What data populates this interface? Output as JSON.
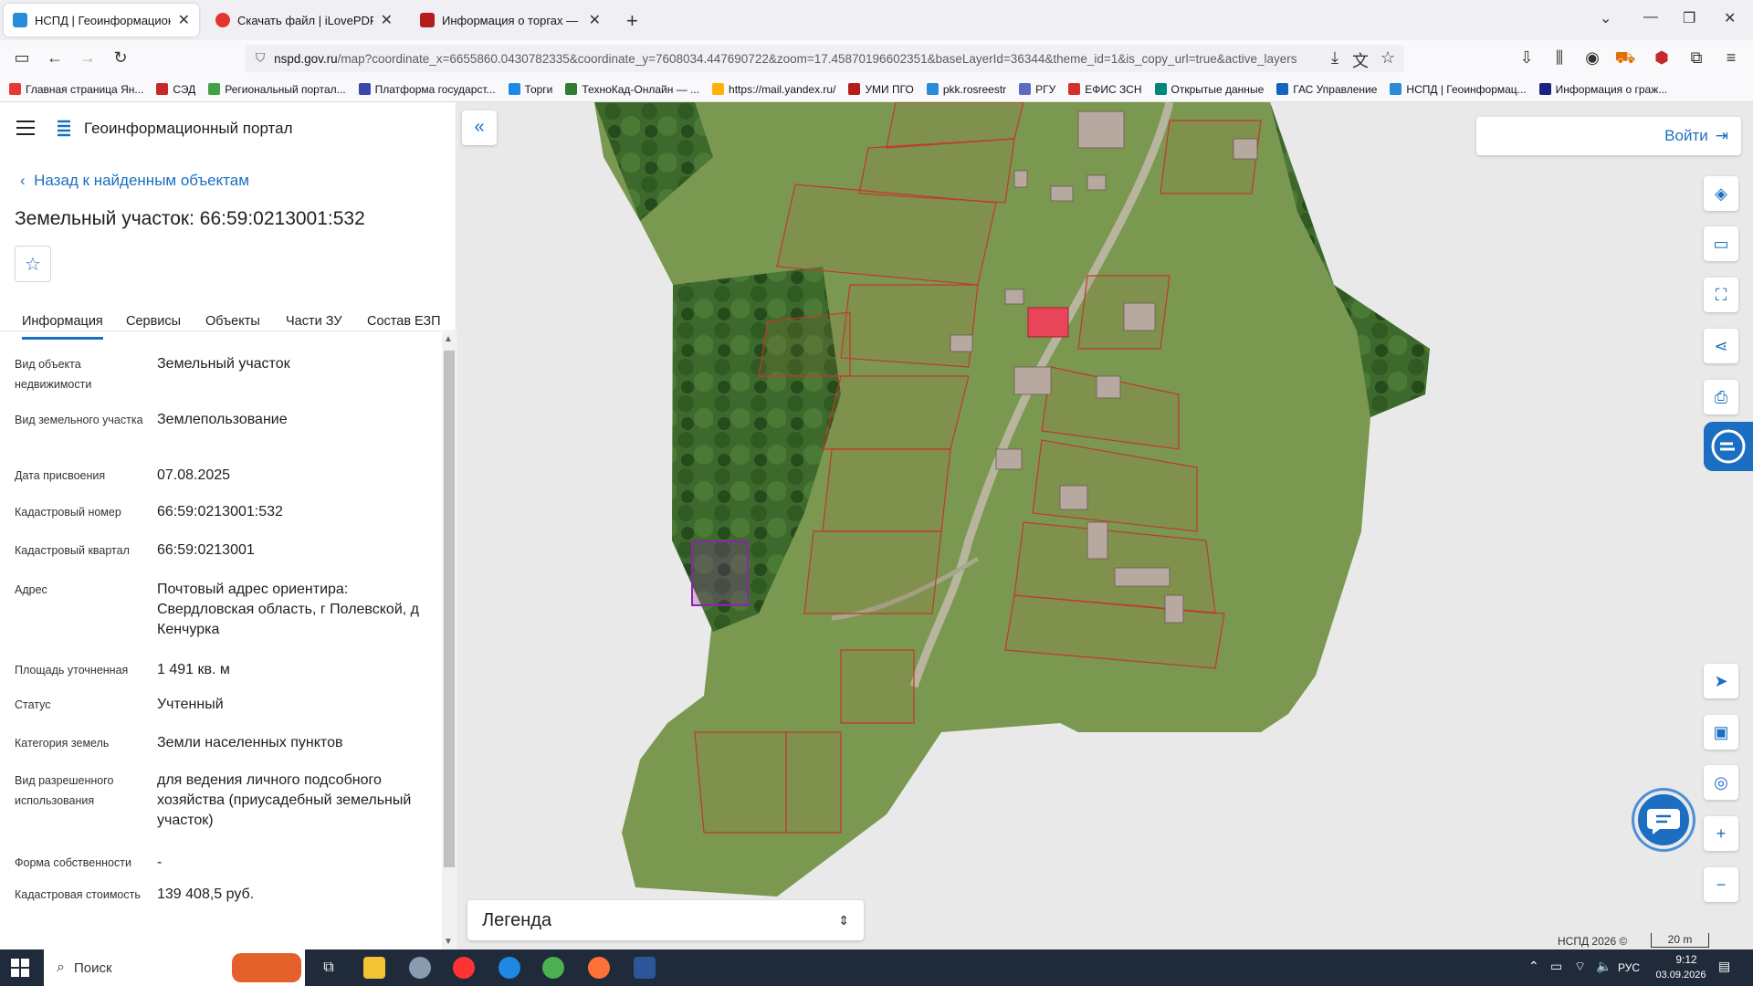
{
  "browser": {
    "tabs": [
      {
        "title": "НСПД | Геоинформационный",
        "active": true
      },
      {
        "title": "Скачать файл | iLovePDF",
        "active": false
      },
      {
        "title": "Информация о торгах — Главная",
        "active": false
      }
    ],
    "url_domain": "nspd.gov.ru",
    "url_rest": "/map?coordinate_x=6655860.0430782335&coordinate_y=7608034.447690722&zoom=17.45870196602351&baseLayerId=36344&theme_id=1&is_copy_url=true&active_layers",
    "bookmarks": [
      "Главная страница Ян...",
      "СЭД",
      "Региональный портал...",
      "Платформа государст...",
      "Торги",
      "ТехноКад-Онлайн — ...",
      "https://mail.yandex.ru/",
      "УМИ ПГО",
      "pkk.rosreestr",
      "РГУ",
      "ЕФИС ЗСН",
      "Открытые данные",
      "ГАС Управление",
      "НСПД | Геоинформац...",
      "Информация о граж..."
    ]
  },
  "app": {
    "title": "Геоинформационный портал",
    "back_link": "Назад к найденным объектам",
    "object_title": "Земельный участок: 66:59:0213001:532",
    "tabs": [
      "Информация",
      "Сервисы",
      "Объекты",
      "Части ЗУ",
      "Состав ЕЗП"
    ],
    "properties": [
      {
        "key": "Вид объекта недвижимости",
        "value": "Земельный участок"
      },
      {
        "key": "Вид земельного участка",
        "value": "Землепользование"
      },
      {
        "key": "Дата присвоения",
        "value": "07.08.2025"
      },
      {
        "key": "Кадастровый номер",
        "value": "66:59:0213001:532"
      },
      {
        "key": "Кадастровый квартал",
        "value": "66:59:0213001"
      },
      {
        "key": "Адрес",
        "value": "Почтовый адрес ориентира: Свердловская область, г Полевской, д Кенчурка"
      },
      {
        "key": "Площадь уточненная",
        "value": "1 491 кв. м"
      },
      {
        "key": "Статус",
        "value": "Учтенный"
      },
      {
        "key": "Категория земель",
        "value": "Земли населенных пунктов"
      },
      {
        "key": "Вид разрешенного использования",
        "value": "для ведения личного подсобного хозяйства (приусадебный земельный участок)"
      },
      {
        "key": "Форма собственности",
        "value": "-"
      },
      {
        "key": "Кадастровая стоимость",
        "value": "139 408,5 руб."
      }
    ]
  },
  "map": {
    "login_label": "Войти",
    "legend_label": "Легенда",
    "credit": "НСПД 2026 ©",
    "scale_label": "20 m"
  },
  "taskbar": {
    "search_placeholder": "Поиск",
    "lang": "РУС",
    "time": "9:12",
    "date": "03.09.2026"
  },
  "colors": {
    "accent": "#1b6ec2",
    "parcel_outline": "#c0392b",
    "selected_parcel": "#8e24aa"
  }
}
